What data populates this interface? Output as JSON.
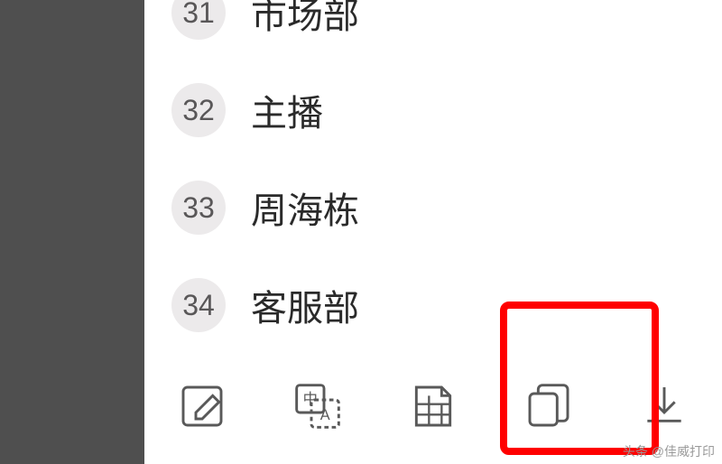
{
  "list": {
    "items": [
      {
        "num": "31",
        "label": "市场部"
      },
      {
        "num": "32",
        "label": "主播"
      },
      {
        "num": "33",
        "label": "周海栋"
      },
      {
        "num": "34",
        "label": "客服部"
      }
    ]
  },
  "toolbar": {
    "edit": "edit",
    "translate": "translate",
    "extract": "extract",
    "copy": "copy",
    "download": "download"
  },
  "watermark": "头条 @佳威打印"
}
